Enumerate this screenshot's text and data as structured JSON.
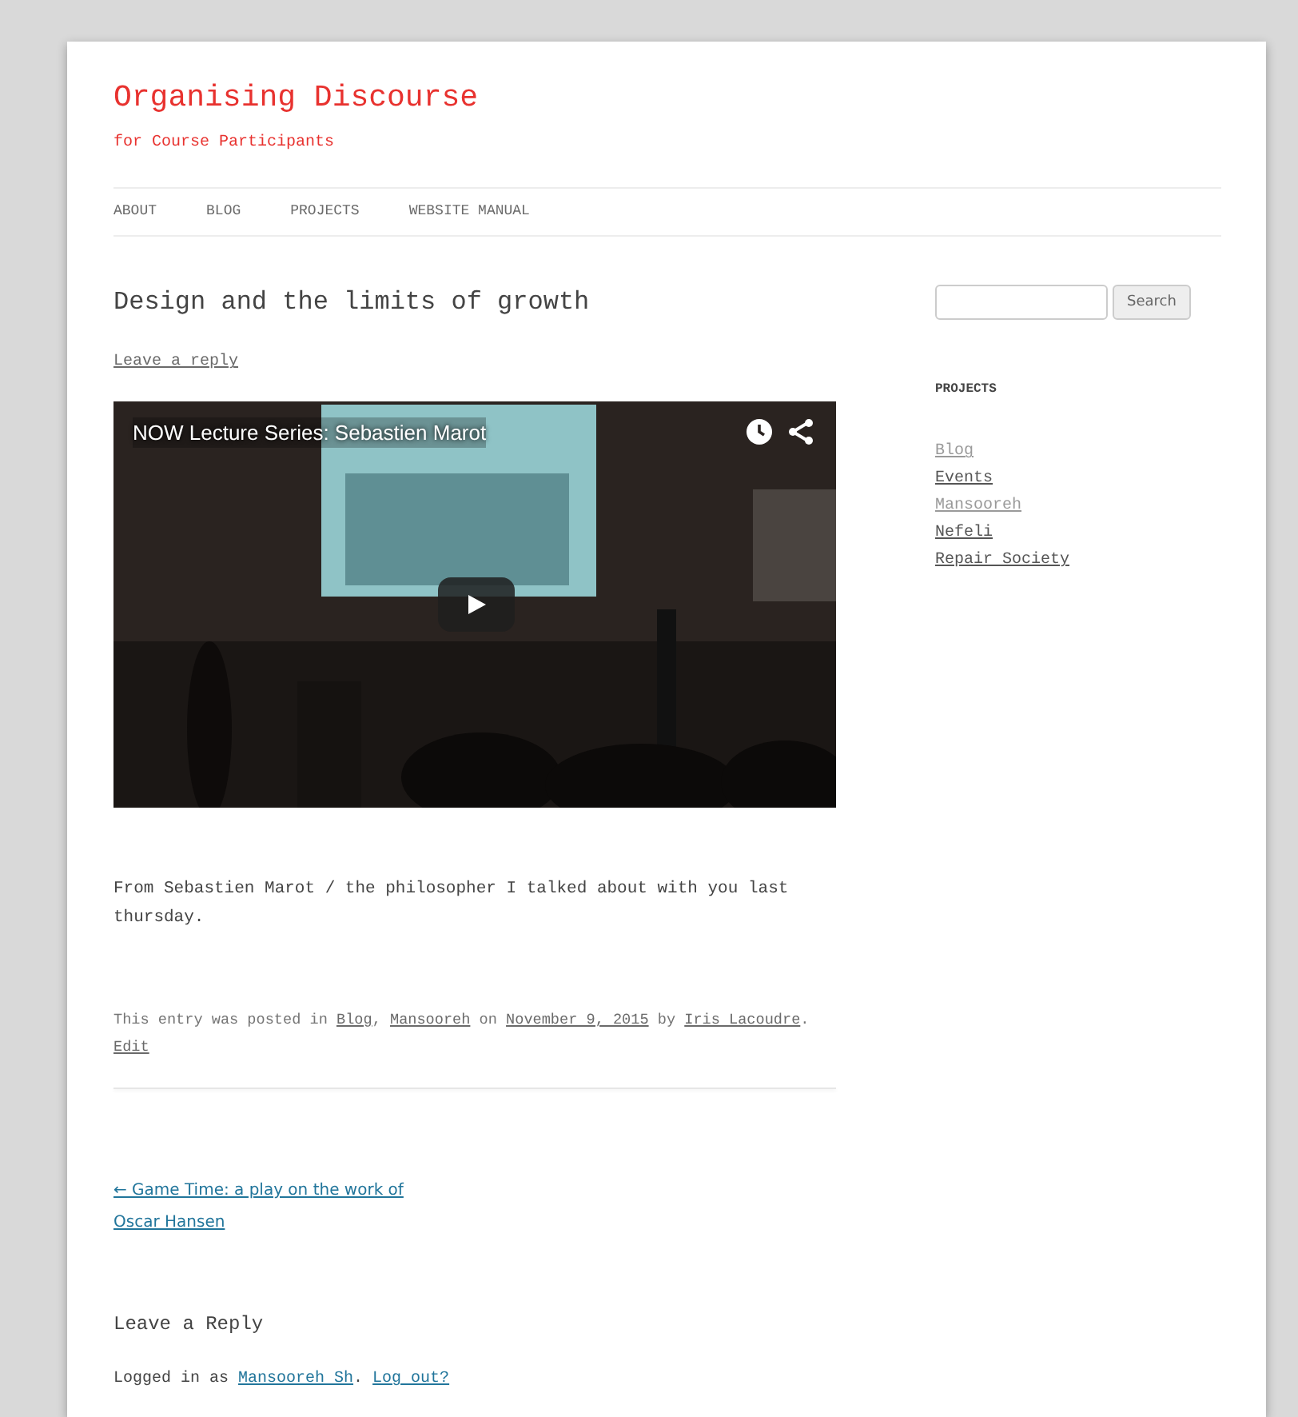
{
  "site": {
    "title": "Organising Discourse",
    "tagline": "for Course Participants"
  },
  "nav": [
    {
      "label": "ABOUT"
    },
    {
      "label": "BLOG"
    },
    {
      "label": "PROJECTS"
    },
    {
      "label": "WEBSITE MANUAL"
    }
  ],
  "post": {
    "title": "Design and the limits of growth",
    "reply_link": "Leave a reply",
    "video": {
      "title": "NOW Lecture Series: Sebastien Marot"
    },
    "body": "From Sebastien Marot / the philosopher I talked about with you last thursday.",
    "meta": [
      {
        "text": "This entry was posted in "
      },
      {
        "link": "Blog"
      },
      {
        "text": ", "
      },
      {
        "link": "Mansooreh"
      },
      {
        "text": " on "
      },
      {
        "link": "November 9, 2015"
      },
      {
        "text": " by "
      },
      {
        "link": "Iris Lacoudre"
      },
      {
        "text": "."
      }
    ],
    "edit_link": "Edit"
  },
  "prev_post": "← Game Time: a play on the work of Oscar Hansen",
  "reply": {
    "heading": "Leave a Reply",
    "logged_in": [
      {
        "text": "Logged in as "
      },
      {
        "link": "Mansooreh Sh"
      },
      {
        "text": ". "
      },
      {
        "link": "Log out?"
      }
    ]
  },
  "sidebar": {
    "search_button": "Search",
    "widget_title": "PROJECTS",
    "links": [
      {
        "label": "Blog",
        "visited": true
      },
      {
        "label": "Events",
        "visited": false
      },
      {
        "label": "Mansooreh",
        "visited": true
      },
      {
        "label": "Nefeli",
        "visited": false
      },
      {
        "label": "Repair Society",
        "visited": false
      }
    ]
  }
}
